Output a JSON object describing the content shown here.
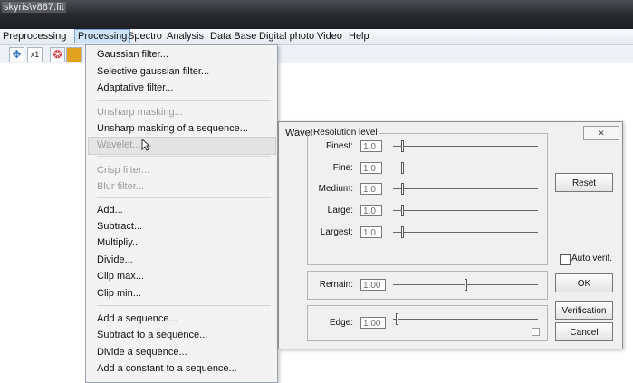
{
  "window": {
    "title": "skyris\\v887.fit"
  },
  "menubar": [
    "Preprocessing",
    "Processing",
    "Spectro",
    "Analysis",
    "Data Base",
    "Digital photo",
    "Video",
    "Help"
  ],
  "toolbar": {
    "x1_label": "x1"
  },
  "menu": {
    "items": [
      {
        "label": "Gaussian filter...",
        "disabled": false
      },
      {
        "label": "Selective gaussian filter...",
        "disabled": false
      },
      {
        "label": "Adaptative filter...",
        "disabled": false
      },
      {
        "label": "Unsharp masking...",
        "disabled": true
      },
      {
        "label": "Unsharp masking of a sequence...",
        "disabled": false
      },
      {
        "label": "Wavelet...",
        "disabled": true
      },
      {
        "label": "Crisp filter...",
        "disabled": true
      },
      {
        "label": "Blur filter...",
        "disabled": true
      },
      {
        "label": "Add...",
        "disabled": false
      },
      {
        "label": "Subtract...",
        "disabled": false
      },
      {
        "label": "Multipliy...",
        "disabled": false
      },
      {
        "label": "Divide...",
        "disabled": false
      },
      {
        "label": "Clip max...",
        "disabled": false
      },
      {
        "label": "Clip min...",
        "disabled": false
      },
      {
        "label": "Add a sequence...",
        "disabled": false
      },
      {
        "label": "Subtract to a sequence...",
        "disabled": false
      },
      {
        "label": "Divide a sequence...",
        "disabled": false
      },
      {
        "label": "Add a constant to a sequence...",
        "disabled": false
      }
    ]
  },
  "dialog": {
    "title": "Wavelet",
    "close_label": "✕",
    "group_label": "Resolution level",
    "levels": [
      {
        "label": "Finest:",
        "value": "1.0",
        "slider": 0.06
      },
      {
        "label": "Fine:",
        "value": "1.0",
        "slider": 0.06
      },
      {
        "label": "Medium:",
        "value": "1.0",
        "slider": 0.06
      },
      {
        "label": "Large:",
        "value": "1.0",
        "slider": 0.06
      },
      {
        "label": "Largest:",
        "value": "1.0",
        "slider": 0.06
      }
    ],
    "remain": {
      "label": "Remain:",
      "value": "1.00",
      "slider": 0.5
    },
    "edge": {
      "label": "Edge:",
      "value": "1.00",
      "slider": 0.02
    },
    "buttons": {
      "reset": "Reset",
      "ok": "OK",
      "verification": "Verification",
      "cancel": "Cancel"
    },
    "auto_verif_label": "Auto verif."
  }
}
